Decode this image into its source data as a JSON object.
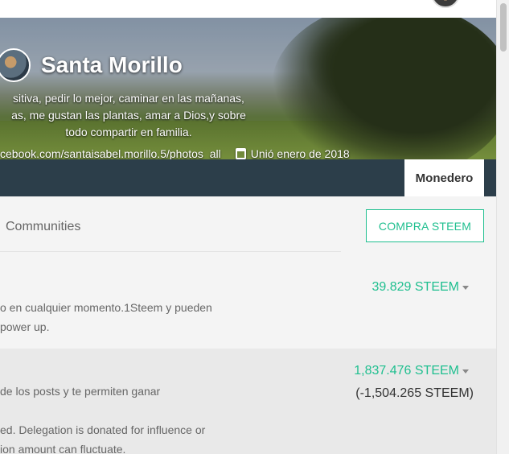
{
  "profile": {
    "name": "Santa Morillo",
    "about_lines": [
      "sitiva, pedir lo mejor, caminar en las mañanas,",
      "as, me gustan las plantas, amar a Dios,y sobre",
      "todo compartir en familia."
    ],
    "website": "cebook.com/santaisabel.morillo.5/photos_all",
    "joined": "Unió enero de 2018"
  },
  "nav": {
    "active_tab": "Monedero"
  },
  "wallet": {
    "communities_label": "Communities",
    "buy_button": "COMPRA STEEM",
    "steem": {
      "balance": "39.829 STEEM",
      "desc_line1": "o en cualquier momento.1Steem y pueden",
      "desc_line2": "power up."
    },
    "steem_power": {
      "balance": "1,837.476 STEEM",
      "delegated": "(-1,504.265 STEEM)",
      "desc_line1": "de los posts y te permiten ganar",
      "desc_line2": "ed. Delegation is donated for influence or",
      "desc_line3": "ion amount can fluctuate."
    }
  },
  "colors": {
    "accent": "#1fbf8f",
    "navbar": "#2c3e4a"
  },
  "icons": [
    "calendar-icon",
    "dropdown-caret-icon"
  ]
}
